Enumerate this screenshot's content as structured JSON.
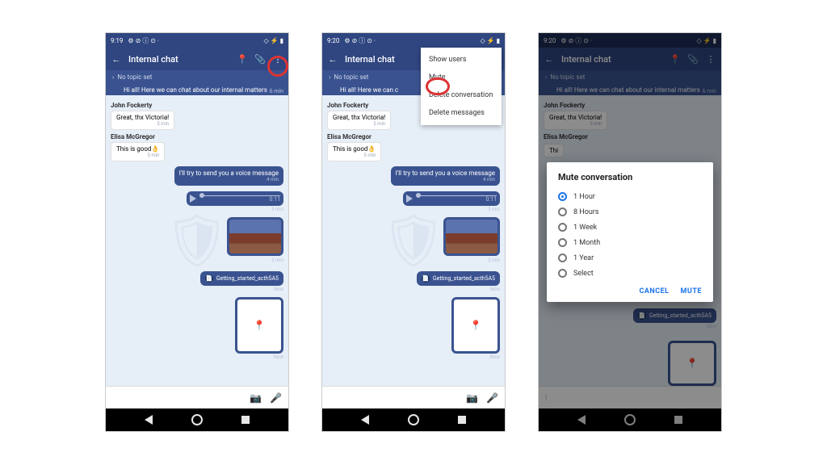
{
  "screens": [
    {
      "time": "9:19",
      "highlight": "kebab"
    },
    {
      "time": "9:20",
      "highlight": "mute-menu"
    },
    {
      "time": "9:20",
      "highlight": "dialog"
    }
  ],
  "status_icons_left": "⚙ ⊘ ⓘ ⊙ ·",
  "status_icons_right": "◇ ⚡ ▮",
  "appbar": {
    "title": "Internal chat"
  },
  "topic": "No topic set",
  "pinned": {
    "text": "Hi all! Here we can chat about our internal matters",
    "ts": "6 min"
  },
  "senders": {
    "john": "John Fockerty",
    "elisa": "Elisa McGregor"
  },
  "messages": {
    "john_text": "Great, thx Victoria!",
    "john_ts": "5 min",
    "elisa_text": "This is good👌",
    "elisa_ts": "5 min",
    "mine1": "I'll try to send you a voice message",
    "mine1_ts": "4 min",
    "voice_dur": "0:11",
    "voice_ts": "3 min",
    "img_ts": "2 min",
    "file": "Getting_started_acth5A5",
    "file_ts": "Now",
    "map_ts": "Now"
  },
  "overflow": {
    "show_users": "Show users",
    "mute": "Mute",
    "delete_conv": "Delete conversation",
    "delete_msgs": "Delete messages"
  },
  "dialog": {
    "title": "Mute conversation",
    "opts": [
      "1 Hour",
      "8 Hours",
      "1 Week",
      "1 Month",
      "1 Year",
      "Select"
    ],
    "cancel": "CANCEL",
    "mute": "MUTE"
  }
}
